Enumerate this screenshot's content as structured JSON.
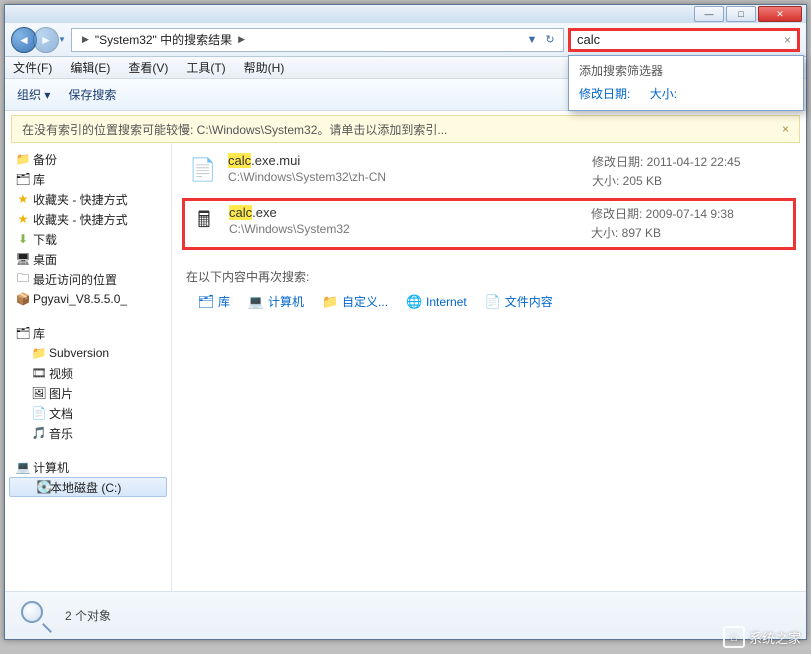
{
  "titlebar": {
    "close_label": "✕",
    "max_label": "□",
    "min_label": "—"
  },
  "nav": {
    "breadcrumb": "\"System32\" 中的搜索结果",
    "separator": "▶",
    "dropdown_glyph": "▼",
    "refresh_glyph": "↻"
  },
  "search": {
    "value": "calc",
    "clear_glyph": "×",
    "filter_header": "添加搜索筛选器",
    "filter_date": "修改日期:",
    "filter_size": "大小:"
  },
  "menus": [
    "文件(F)",
    "编辑(E)",
    "查看(V)",
    "工具(T)",
    "帮助(H)"
  ],
  "toolbar": {
    "organize": "组织 ▾",
    "save_search": "保存搜索",
    "view_glyph": "▦",
    "help_glyph": "?"
  },
  "infobar": {
    "text": "在没有索引的位置搜索可能较慢: C:\\Windows\\System32。请单击以添加到索引...",
    "close": "×"
  },
  "sidebar": {
    "items": [
      {
        "label": "备份",
        "icon": "📁",
        "top": true
      },
      {
        "label": "库",
        "icon": "🗂",
        "top": true
      },
      {
        "label": "收藏夹 - 快捷方式",
        "icon": "★",
        "top": true,
        "color": "#f2b200"
      },
      {
        "label": "收藏夹 - 快捷方式",
        "icon": "★",
        "top": true,
        "color": "#f2b200"
      },
      {
        "label": "下载",
        "icon": "⬇",
        "top": true,
        "color": "#86b34b"
      },
      {
        "label": "桌面",
        "icon": "🖥",
        "top": true
      },
      {
        "label": "最近访问的位置",
        "icon": "🗀",
        "top": true
      },
      {
        "label": "Pgyavi_V8.5.5.0_",
        "icon": "📦",
        "top": true
      }
    ],
    "libraries_header": "库",
    "libraries": [
      {
        "label": "Subversion",
        "icon": "📁"
      },
      {
        "label": "视频",
        "icon": "🎞"
      },
      {
        "label": "图片",
        "icon": "🖼"
      },
      {
        "label": "文档",
        "icon": "📄"
      },
      {
        "label": "音乐",
        "icon": "🎵"
      }
    ],
    "computer_header": "计算机",
    "computer": [
      {
        "label": "本地磁盘 (C:)",
        "icon": "💽",
        "selected": true
      }
    ]
  },
  "results": [
    {
      "name_hl": "calc",
      "name_rest": ".exe.mui",
      "path": "C:\\Windows\\System32\\zh-CN",
      "date_label": "修改日期:",
      "date": "2011-04-12 22:45",
      "size_label": "大小:",
      "size": "205 KB",
      "icon": "📄",
      "boxed": false
    },
    {
      "name_hl": "calc",
      "name_rest": ".exe",
      "path": "C:\\Windows\\System32",
      "date_label": "修改日期:",
      "date": "2009-07-14 9:38",
      "size_label": "大小:",
      "size": "897 KB",
      "icon": "🖩",
      "boxed": true
    }
  ],
  "search_again": {
    "header": "在以下内容中再次搜索:",
    "links": [
      {
        "label": "库",
        "icon": "🗂"
      },
      {
        "label": "计算机",
        "icon": "💻"
      },
      {
        "label": "自定义...",
        "icon": "📁"
      },
      {
        "label": "Internet",
        "icon": "🌐"
      },
      {
        "label": "文件内容",
        "icon": "📄"
      }
    ]
  },
  "status": {
    "text": "2 个对象"
  },
  "watermark": "系统之家"
}
